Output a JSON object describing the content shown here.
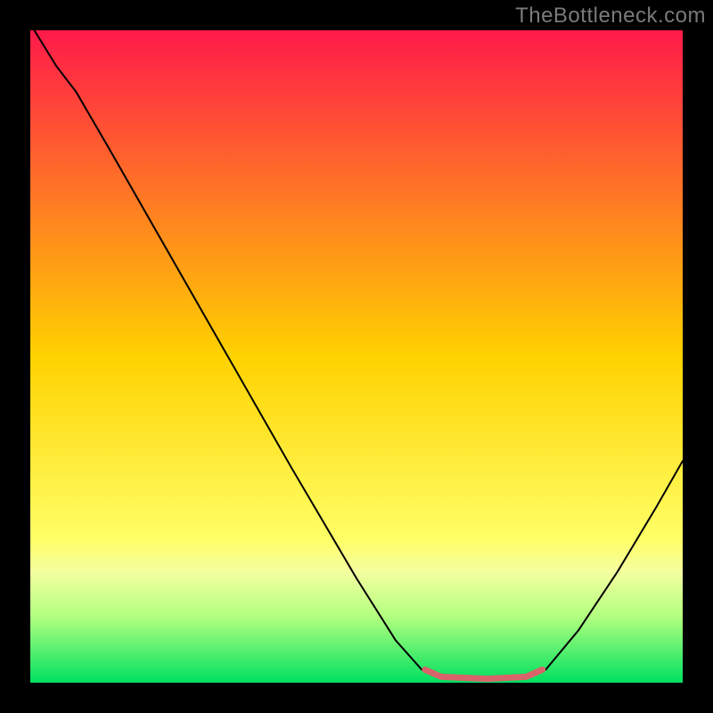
{
  "watermark": "TheBottleneck.com",
  "chart_data": {
    "type": "line",
    "title": "",
    "xlabel": "",
    "ylabel": "",
    "xlim": [
      0,
      100
    ],
    "ylim": [
      0,
      100
    ],
    "grid": false,
    "legend": false,
    "background_gradient": {
      "stops": [
        {
          "offset": 0,
          "color": "#ff1a4a"
        },
        {
          "offset": 50,
          "color": "#ffd200"
        },
        {
          "offset": 78,
          "color": "#ffff66"
        },
        {
          "offset": 83,
          "color": "#f4ffa0"
        },
        {
          "offset": 90,
          "color": "#b0ff7e"
        },
        {
          "offset": 100,
          "color": "#00e060"
        }
      ]
    },
    "series": [
      {
        "name": "bottleneck-curve",
        "stroke": "#000000",
        "stroke_width": 2,
        "points": [
          {
            "x": 0.0,
            "y": 101.0
          },
          {
            "x": 4.0,
            "y": 94.5
          },
          {
            "x": 7.0,
            "y": 90.6
          },
          {
            "x": 12.0,
            "y": 82.0
          },
          {
            "x": 20.0,
            "y": 68.0
          },
          {
            "x": 30.0,
            "y": 50.5
          },
          {
            "x": 40.0,
            "y": 33.0
          },
          {
            "x": 50.0,
            "y": 16.0
          },
          {
            "x": 56.0,
            "y": 6.5
          },
          {
            "x": 60.0,
            "y": 2.0
          },
          {
            "x": 63.0,
            "y": 0.8
          },
          {
            "x": 70.0,
            "y": 0.5
          },
          {
            "x": 76.0,
            "y": 0.8
          },
          {
            "x": 79.0,
            "y": 2.0
          },
          {
            "x": 84.0,
            "y": 8.0
          },
          {
            "x": 90.0,
            "y": 17.0
          },
          {
            "x": 96.0,
            "y": 27.0
          },
          {
            "x": 100.0,
            "y": 34.0
          }
        ]
      },
      {
        "name": "optimal-band",
        "stroke": "#d9636a",
        "stroke_width": 7,
        "points": [
          {
            "x": 60.5,
            "y": 2.0
          },
          {
            "x": 63.0,
            "y": 0.9
          },
          {
            "x": 70.0,
            "y": 0.6
          },
          {
            "x": 76.0,
            "y": 0.9
          },
          {
            "x": 78.5,
            "y": 2.0
          }
        ]
      }
    ]
  }
}
